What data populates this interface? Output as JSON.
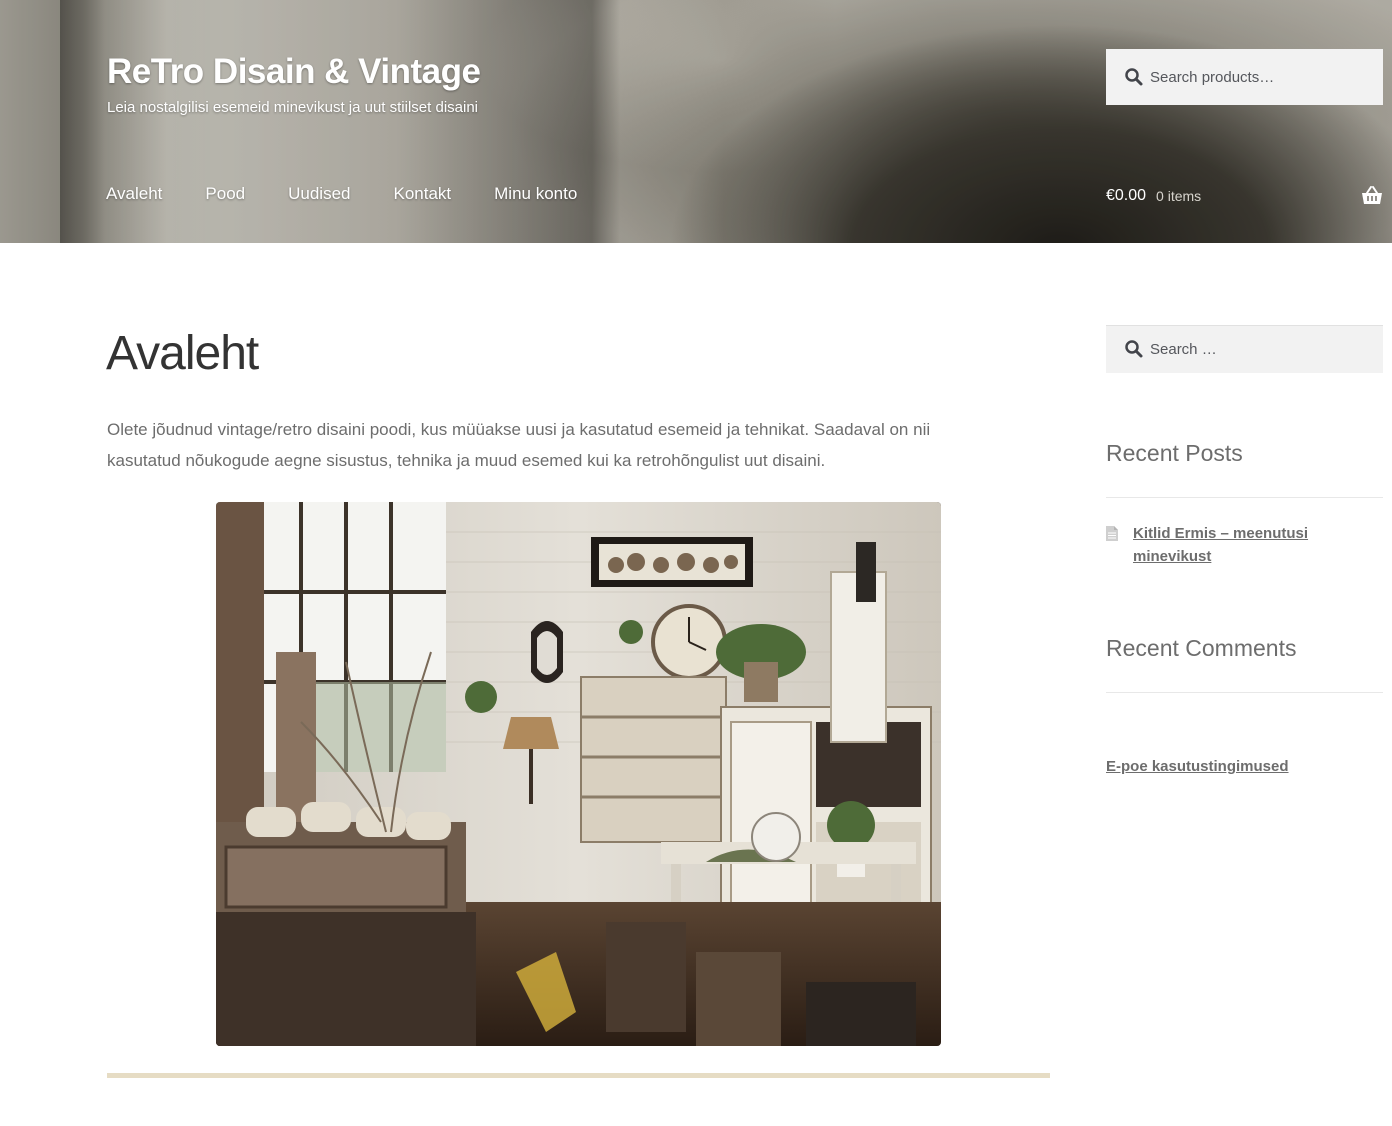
{
  "site": {
    "title": "ReTro Disain & Vintage",
    "description": "Leia nostalgilisi esemeid minevikust ja uut stiilset disaini"
  },
  "header_search": {
    "placeholder": "Search products…",
    "icon": "search-icon"
  },
  "nav": {
    "items": [
      "Avaleht",
      "Pood",
      "Uudised",
      "Kontakt",
      "Minu konto"
    ]
  },
  "cart": {
    "amount": "€0.00",
    "count": "0 items",
    "icon": "basket-icon"
  },
  "page": {
    "title": "Avaleht",
    "intro": "Olete jõudnud vintage/retro disaini poodi, kus müüakse uusi ja kasutatud esemeid ja tehnikat. Saadaval on nii kasutatud nõukogude aegne sisustus, tehnika ja muud esemed kui ka retrohõngulist uut disaini.",
    "image": "vintage-interior-photo"
  },
  "sidebar": {
    "search": {
      "placeholder": "Search …",
      "icon": "search-icon"
    },
    "recent_posts": {
      "title": "Recent Posts",
      "items": [
        "Kitlid Ermis – meenutusi minevikust"
      ]
    },
    "recent_comments": {
      "title": "Recent Comments"
    },
    "terms_link": "E-poe kasutustingimused"
  },
  "colors": {
    "accent_rule": "#e6dcc4",
    "text": "#6d6d6d",
    "title": "#333333"
  }
}
